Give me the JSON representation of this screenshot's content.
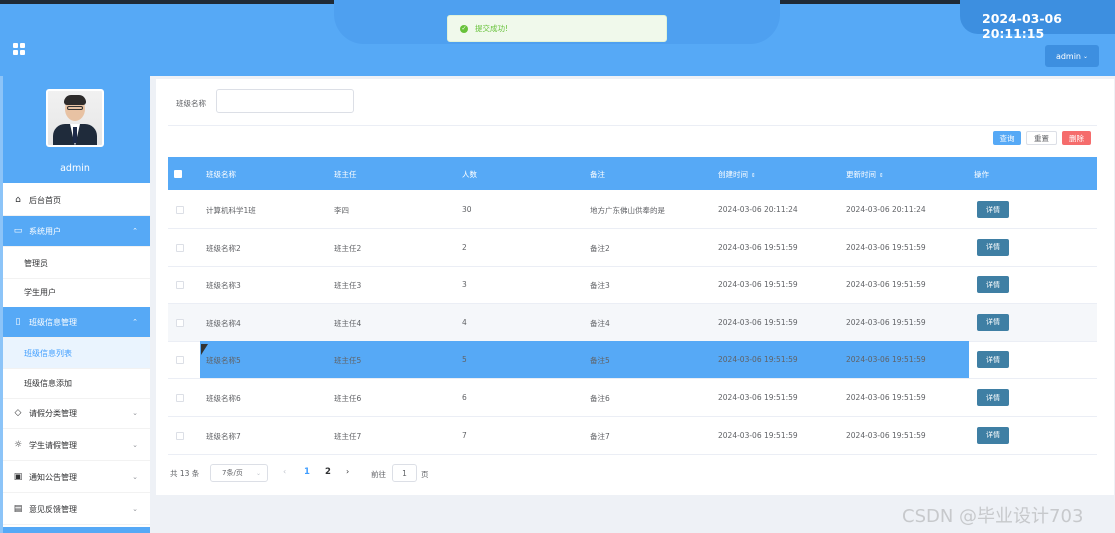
{
  "header": {
    "clock": "2024-03-06 20:11:15",
    "user_menu_label": "admin",
    "toast_message": "提交成功!"
  },
  "sidebar": {
    "username": "admin",
    "items": [
      {
        "label": "后台首页",
        "icon": "home-icon"
      },
      {
        "label": "系统用户",
        "icon": "monitor-icon"
      },
      {
        "label": "管理员"
      },
      {
        "label": "学生用户"
      },
      {
        "label": "班级信息管理",
        "icon": "bookmark-icon"
      },
      {
        "label": "班级信息列表"
      },
      {
        "label": "班级信息添加"
      },
      {
        "label": "请假分类管理",
        "icon": "tag-icon"
      },
      {
        "label": "学生请假管理",
        "icon": "sun-icon"
      },
      {
        "label": "通知公告管理",
        "icon": "mail-box-icon"
      },
      {
        "label": "意见反馈管理",
        "icon": "clipboard-icon"
      }
    ]
  },
  "search": {
    "label": "班级名称",
    "value": ""
  },
  "actions": {
    "query": "查询",
    "reset": "重置",
    "delete": "删除"
  },
  "table": {
    "columns": [
      "班级名称",
      "班主任",
      "人数",
      "备注",
      "创建时间",
      "更新时间",
      "操作"
    ],
    "detail_label": "详情",
    "rows": [
      {
        "name": "计算机科学1班",
        "teacher": "李四",
        "count": "30",
        "note": "地方广东佛山供奉的是",
        "created": "2024-03-06 20:11:24",
        "updated": "2024-03-06 20:11:24"
      },
      {
        "name": "班级名称2",
        "teacher": "班主任2",
        "count": "2",
        "note": "备注2",
        "created": "2024-03-06 19:51:59",
        "updated": "2024-03-06 19:51:59"
      },
      {
        "name": "班级名称3",
        "teacher": "班主任3",
        "count": "3",
        "note": "备注3",
        "created": "2024-03-06 19:51:59",
        "updated": "2024-03-06 19:51:59"
      },
      {
        "name": "班级名称4",
        "teacher": "班主任4",
        "count": "4",
        "note": "备注4",
        "created": "2024-03-06 19:51:59",
        "updated": "2024-03-06 19:51:59"
      },
      {
        "name": "班级名称5",
        "teacher": "班主任5",
        "count": "5",
        "note": "备注5",
        "created": "2024-03-06 19:51:59",
        "updated": "2024-03-06 19:51:59"
      },
      {
        "name": "班级名称6",
        "teacher": "班主任6",
        "count": "6",
        "note": "备注6",
        "created": "2024-03-06 19:51:59",
        "updated": "2024-03-06 19:51:59"
      },
      {
        "name": "班级名称7",
        "teacher": "班主任7",
        "count": "7",
        "note": "备注7",
        "created": "2024-03-06 19:51:59",
        "updated": "2024-03-06 19:51:59"
      }
    ]
  },
  "pagination": {
    "total_text": "共 13 条",
    "page_size": "7条/页",
    "pages": [
      "1",
      "2"
    ],
    "current_page": "1",
    "goto_label": "前往",
    "goto_value": "1",
    "page_unit": "页"
  },
  "watermark": "CSDN @毕业设计703",
  "colors": {
    "primary": "#56a9f6",
    "danger": "#f56c6c",
    "success": "#67c23a",
    "detail_button": "#3f7fa4"
  }
}
